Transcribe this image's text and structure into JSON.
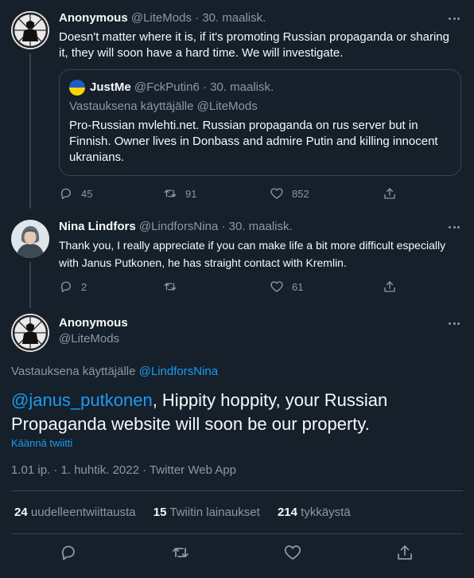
{
  "tweet1": {
    "name": "Anonymous",
    "handle": "@LiteMods",
    "date": "· 30. maalisk.",
    "text": "Doesn't matter where it is, if it's promoting Russian propaganda or sharing it, they will soon have a hard time. We will investigate.",
    "quote": {
      "name": "JustMe",
      "handle": "@FckPutin6",
      "date": "· 30. maalisk.",
      "reply_to": "Vastauksena käyttäjälle @LiteMods",
      "text": "Pro-Russian mvlehti.net. Russian propaganda on rus server but in Finnish. Owner lives in Donbass and admire Putin and killing innocent ukranians."
    },
    "replies": "45",
    "retweets": "91",
    "likes": "852"
  },
  "tweet2": {
    "name": "Nina Lindfors",
    "handle": "@LindforsNina",
    "date": "· 30. maalisk.",
    "text": "Thank you, I really appreciate if you can make life a bit more difficult especially with Janus Putkonen, he has straight contact with Kremlin.",
    "replies": "2",
    "retweets": "",
    "likes": "61"
  },
  "main": {
    "name": "Anonymous",
    "handle": "@LiteMods",
    "reply_prefix": "Vastauksena käyttäjälle",
    "reply_to": "@LindforsNina",
    "mention": "@janus_putkonen",
    "text": ", Hippity hoppity, your Russian Propaganda website will soon be our property.",
    "translate": "Käännä twiitti",
    "meta": "1.01 ip. · 1. huhtik. 2022 · Twitter Web App",
    "retweets_count": "24",
    "retweets_label": "uudelleentwiittausta",
    "quotes_count": "15",
    "quotes_label": "Twiitin lainaukset",
    "likes_count": "214",
    "likes_label": "tykkäystä"
  },
  "colors": {
    "background": "#15202b",
    "text": "#f7f9f9",
    "muted": "#8b98a5",
    "accent": "#1d9bf0",
    "border": "#38444d"
  }
}
